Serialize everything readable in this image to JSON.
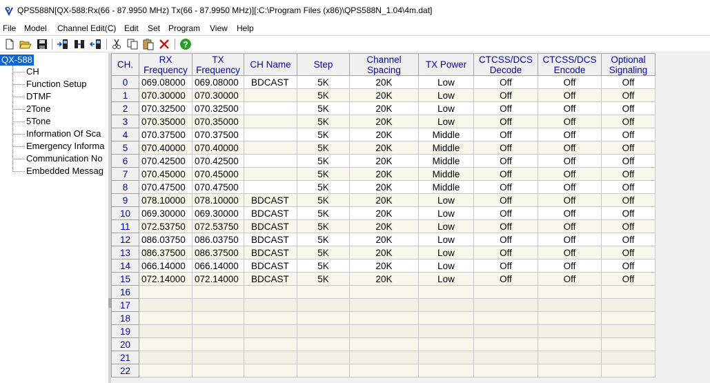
{
  "window": {
    "title": "QPS588N[QX-588:Rx(66 - 87.9950 MHz) Tx(66 - 87.9950 MHz)][:C:\\Program Files (x86)\\QPS588N_1.04\\4m.dat]"
  },
  "menu": [
    "File",
    "Model",
    "Channel Edit(C)",
    "Edit",
    "Set",
    "Program",
    "View",
    "Help"
  ],
  "toolbar": {
    "buttons": [
      "new-file-icon",
      "open-folder-icon",
      "save-disk-icon",
      "read-radio-icon",
      "radio-settings-icon",
      "write-radio-icon",
      "cut-icon",
      "copy-icon",
      "paste-icon",
      "delete-icon",
      "help-icon"
    ]
  },
  "tree": {
    "root": "QX-588",
    "items": [
      "CH",
      "Function Setup",
      "DTMF",
      "2Tone",
      "5Tone",
      "Information Of Sca",
      "Emergency Informa",
      "Communication No",
      "Embedded Messag"
    ]
  },
  "table": {
    "headers": [
      "CH.",
      "RX Frequency",
      "TX Frequency",
      "CH Name",
      "Step",
      "Channel Spacing",
      "TX Power",
      "CTCSS/DCS Decode",
      "CTCSS/DCS Encode",
      "Optional Signaling"
    ],
    "rows": [
      [
        "0",
        "069.08000",
        "069.08000",
        "BDCAST",
        "5K",
        "20K",
        "Low",
        "Off",
        "Off",
        "Off"
      ],
      [
        "1",
        "070.30000",
        "070.30000",
        "",
        "5K",
        "20K",
        "Low",
        "Off",
        "Off",
        "Off"
      ],
      [
        "2",
        "070.32500",
        "070.32500",
        "",
        "5K",
        "20K",
        "Low",
        "Off",
        "Off",
        "Off"
      ],
      [
        "3",
        "070.35000",
        "070.35000",
        "",
        "5K",
        "20K",
        "Low",
        "Off",
        "Off",
        "Off"
      ],
      [
        "4",
        "070.37500",
        "070.37500",
        "",
        "5K",
        "20K",
        "Middle",
        "Off",
        "Off",
        "Off"
      ],
      [
        "5",
        "070.40000",
        "070.40000",
        "",
        "5K",
        "20K",
        "Middle",
        "Off",
        "Off",
        "Off"
      ],
      [
        "6",
        "070.42500",
        "070.42500",
        "",
        "5K",
        "20K",
        "Middle",
        "Off",
        "Off",
        "Off"
      ],
      [
        "7",
        "070.45000",
        "070.45000",
        "",
        "5K",
        "20K",
        "Middle",
        "Off",
        "Off",
        "Off"
      ],
      [
        "8",
        "070.47500",
        "070.47500",
        "",
        "5K",
        "20K",
        "Middle",
        "Off",
        "Off",
        "Off"
      ],
      [
        "9",
        "078.10000",
        "078.10000",
        "BDCAST",
        "5K",
        "20K",
        "Low",
        "Off",
        "Off",
        "Off"
      ],
      [
        "10",
        "069.30000",
        "069.30000",
        "BDCAST",
        "5K",
        "20K",
        "Low",
        "Off",
        "Off",
        "Off"
      ],
      [
        "11",
        "072.53750",
        "072.53750",
        "BDCAST",
        "5K",
        "20K",
        "Low",
        "Off",
        "Off",
        "Off"
      ],
      [
        "12",
        "086.03750",
        "086.03750",
        "BDCAST",
        "5K",
        "20K",
        "Low",
        "Off",
        "Off",
        "Off"
      ],
      [
        "13",
        "086.37500",
        "086.37500",
        "BDCAST",
        "5K",
        "20K",
        "Low",
        "Off",
        "Off",
        "Off"
      ],
      [
        "14",
        "066.14000",
        "066.14000",
        "BDCAST",
        "5K",
        "20K",
        "Low",
        "Off",
        "Off",
        "Off"
      ],
      [
        "15",
        "072.14000",
        "072.14000",
        "BDCAST",
        "5K",
        "20K",
        "Low",
        "Off",
        "Off",
        "Off"
      ],
      [
        "16",
        "",
        "",
        "",
        "",
        "",
        "",
        "",
        "",
        ""
      ],
      [
        "17",
        "",
        "",
        "",
        "",
        "",
        "",
        "",
        "",
        ""
      ],
      [
        "18",
        "",
        "",
        "",
        "",
        "",
        "",
        "",
        "",
        ""
      ],
      [
        "19",
        "",
        "",
        "",
        "",
        "",
        "",
        "",
        "",
        ""
      ],
      [
        "20",
        "",
        "",
        "",
        "",
        "",
        "",
        "",
        "",
        ""
      ],
      [
        "21",
        "",
        "",
        "",
        "",
        "",
        "",
        "",
        "",
        ""
      ],
      [
        "22",
        "",
        "",
        "",
        "",
        "",
        "",
        "",
        "",
        ""
      ]
    ]
  }
}
